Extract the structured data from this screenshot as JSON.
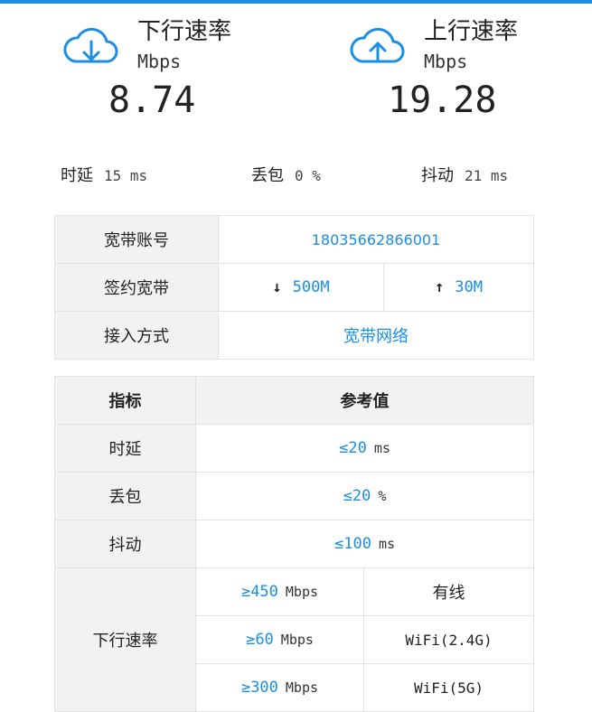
{
  "colors": {
    "accent": "#1a8fe3",
    "label_bg": "#f2f2f2",
    "border": "#e2e2e2"
  },
  "download": {
    "icon": "cloud-download-icon",
    "title": "下行速率",
    "unit": "Mbps",
    "value": "8.74"
  },
  "upload": {
    "icon": "cloud-upload-icon",
    "title": "上行速率",
    "unit": "Mbps",
    "value": "19.28"
  },
  "stats": {
    "latency": {
      "label": "时延",
      "value": "15 ms"
    },
    "loss": {
      "label": "丢包",
      "value": "0 %"
    },
    "jitter": {
      "label": "抖动",
      "value": "21 ms"
    }
  },
  "account": {
    "account_label": "宽带账号",
    "account_value": "18035662866001",
    "plan_label": "签约宽带",
    "plan_down_arrow": "↓",
    "plan_down": "500M",
    "plan_up_arrow": "↑",
    "plan_up": "30M",
    "access_label": "接入方式",
    "access_value": "宽带网络"
  },
  "reference": {
    "header_metric": "指标",
    "header_value": "参考值",
    "rows": [
      {
        "label": "时延",
        "value": "≤20",
        "unit": "ms"
      },
      {
        "label": "丢包",
        "value": "≤20",
        "unit": "%"
      },
      {
        "label": "抖动",
        "value": "≤100",
        "unit": "ms"
      }
    ],
    "download_label": "下行速率",
    "download_rows": [
      {
        "value": "≥450",
        "unit": "Mbps",
        "type": "有线"
      },
      {
        "value": "≥60",
        "unit": "Mbps",
        "type": "WiFi(2.4G)"
      },
      {
        "value": "≥300",
        "unit": "Mbps",
        "type": "WiFi(5G)"
      }
    ]
  }
}
